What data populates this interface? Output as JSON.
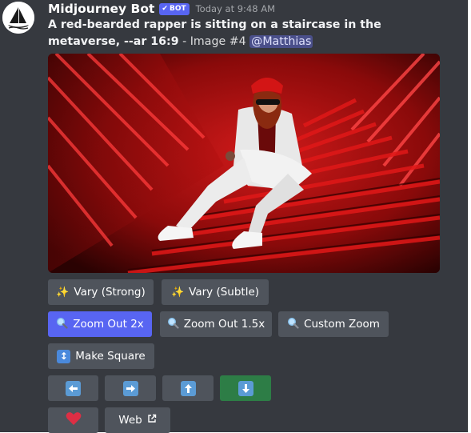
{
  "message": {
    "author": "Midjourney Bot",
    "badge": "BOT",
    "timestamp": "Today at 9:48 AM",
    "prompt": "A red-bearded rapper is sitting on a staircase in the metaverse, --ar 16:9",
    "image_label": " - Image #4 ",
    "mention": "@Matthias"
  },
  "buttons": {
    "vary_strong": "Vary (Strong)",
    "vary_subtle": "Vary (Subtle)",
    "zoom_out_2x": "Zoom Out 2x",
    "zoom_out_15x": "Zoom Out 1.5x",
    "custom_zoom": "Custom Zoom",
    "make_square": "Make Square",
    "web": "Web"
  },
  "icons": {
    "vary": "sparkles-icon",
    "zoom": "magnifier-icon",
    "square": "up-down-arrows-icon",
    "pan_left": "left-arrow-icon",
    "pan_right": "right-arrow-icon",
    "pan_up": "up-arrow-icon",
    "pan_down": "down-arrow-icon",
    "favorite": "heart-icon",
    "external": "external-link-icon"
  },
  "colors": {
    "background": "#36393f",
    "button": "#4f545c",
    "primary": "#5865f2",
    "success": "#2d7d46",
    "mention": "#4a4f8a"
  }
}
